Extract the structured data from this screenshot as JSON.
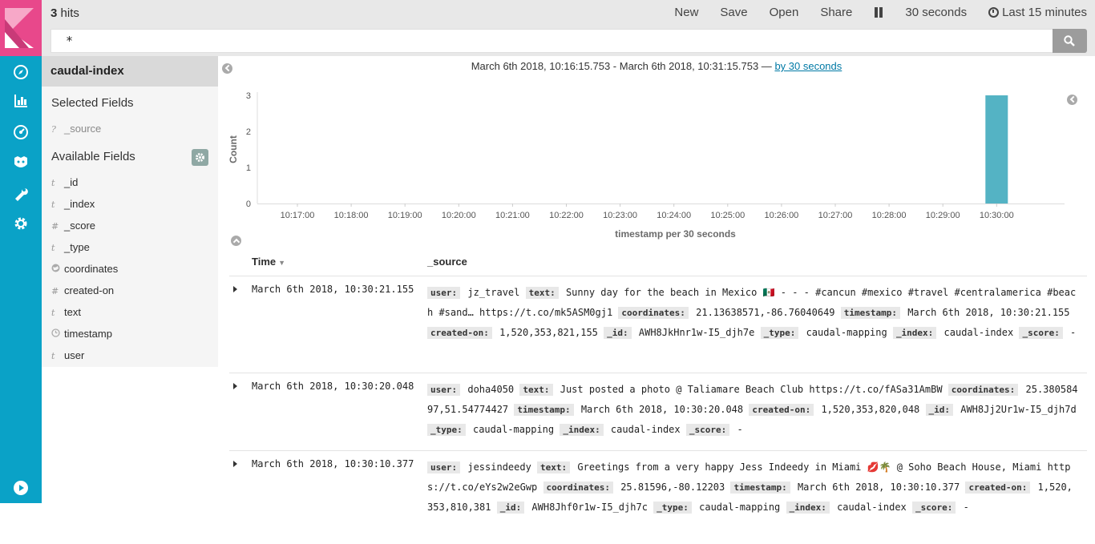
{
  "topbar": {
    "hits_count": "3",
    "hits_label": "hits",
    "menu": {
      "new": "New",
      "save": "Save",
      "open": "Open",
      "share": "Share"
    },
    "refresh_interval": "30 seconds",
    "time_range": "Last 15 minutes"
  },
  "search": {
    "query": "*"
  },
  "sidebar": {
    "index_name": "caudal-index",
    "selected_title": "Selected Fields",
    "selected_fields": [
      {
        "type": "?",
        "name": "_source"
      }
    ],
    "available_title": "Available Fields",
    "available_fields": [
      {
        "type": "t",
        "name": "_id"
      },
      {
        "type": "t",
        "name": "_index"
      },
      {
        "type": "#",
        "name": "_score"
      },
      {
        "type": "t",
        "name": "_type"
      },
      {
        "type": "geo",
        "name": "coordinates"
      },
      {
        "type": "#",
        "name": "created-on"
      },
      {
        "type": "t",
        "name": "text"
      },
      {
        "type": "clock",
        "name": "timestamp"
      },
      {
        "type": "t",
        "name": "user"
      }
    ]
  },
  "histogram": {
    "range_text": "March 6th 2018, 10:16:15.753 - March 6th 2018, 10:31:15.753 —",
    "interval_link": "by 30 seconds"
  },
  "chart_data": {
    "type": "bar",
    "xlabel": "timestamp per 30 seconds",
    "ylabel": "Count",
    "ylim": [
      0,
      3
    ],
    "yticks": [
      0,
      1,
      2,
      3
    ],
    "xticks": [
      "10:17:00",
      "10:18:00",
      "10:19:00",
      "10:20:00",
      "10:21:00",
      "10:22:00",
      "10:23:00",
      "10:24:00",
      "10:25:00",
      "10:26:00",
      "10:27:00",
      "10:28:00",
      "10:29:00",
      "10:30:00"
    ],
    "categories": [
      "10:30:00"
    ],
    "values": [
      3
    ],
    "bar_color": "#54b3c4",
    "grid": false
  },
  "table": {
    "headers": {
      "time": "Time",
      "source": "_source"
    },
    "rows": [
      {
        "time": "March 6th 2018, 10:30:21.155",
        "source": [
          [
            "user:",
            "jz_travel"
          ],
          [
            "text:",
            "Sunny day for the beach in Mexico 🇲🇽 - - - #cancun #mexico #travel #centralamerica #beach #sand… https://t.co/mk5ASM0gj1"
          ],
          [
            "coordinates:",
            "21.13638571,-86.76040649"
          ],
          [
            "timestamp:",
            "March 6th 2018, 10:30:21.155"
          ],
          [
            "created-on:",
            "1,520,353,821,155"
          ],
          [
            "_id:",
            "AWH8JkHnr1w-I5_djh7e"
          ],
          [
            "_type:",
            "caudal-mapping"
          ],
          [
            "_index:",
            "caudal-index"
          ],
          [
            "_score:",
            "-"
          ]
        ]
      },
      {
        "time": "March 6th 2018, 10:30:20.048",
        "source": [
          [
            "user:",
            "doha4050"
          ],
          [
            "text:",
            "Just posted a photo @ Taliamare Beach Club https://t.co/fASa31AmBW"
          ],
          [
            "coordinates:",
            "25.38058497,51.54774427"
          ],
          [
            "timestamp:",
            "March 6th 2018, 10:30:20.048"
          ],
          [
            "created-on:",
            "1,520,353,820,048"
          ],
          [
            "_id:",
            "AWH8Jj2Ur1w-I5_djh7d"
          ],
          [
            "_type:",
            "caudal-mapping"
          ],
          [
            "_index:",
            "caudal-index"
          ],
          [
            "_score:",
            "-"
          ]
        ]
      },
      {
        "time": "March 6th 2018, 10:30:10.377",
        "source": [
          [
            "user:",
            "jessindeedy"
          ],
          [
            "text:",
            "Greetings from a very happy Jess Indeedy in Miami 💋🌴 @ Soho Beach House, Miami https://t.co/eYs2w2eGwp"
          ],
          [
            "coordinates:",
            "25.81596,-80.12203"
          ],
          [
            "timestamp:",
            "March 6th 2018, 10:30:10.377"
          ],
          [
            "created-on:",
            "1,520,353,810,381"
          ],
          [
            "_id:",
            "AWH8Jhf0r1w-I5_djh7c"
          ],
          [
            "_type:",
            "caudal-mapping"
          ],
          [
            "_index:",
            "caudal-index"
          ],
          [
            "_score:",
            "-"
          ]
        ]
      }
    ]
  },
  "nav": {
    "icons": [
      "discover-icon",
      "visualize-icon",
      "dashboard-icon",
      "timelion-icon",
      "devtools-icon",
      "management-icon",
      "collapse-play-icon"
    ]
  }
}
